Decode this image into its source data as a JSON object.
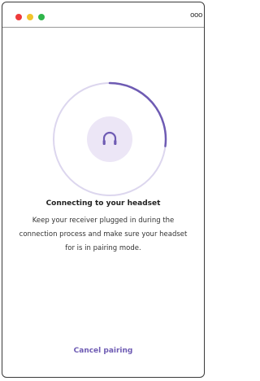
{
  "window": {
    "controls": [
      "close",
      "minimize",
      "maximize"
    ],
    "more_icon": "more-dots-icon",
    "more_glyph": "ooo"
  },
  "status": {
    "icon": "headset-icon",
    "progress": 0.27,
    "title": "Connecting to your headset",
    "description": "Keep your receiver plugged in during the connection process and make sure your headset for is in pairing mode."
  },
  "actions": {
    "cancel_label": "Cancel pairing"
  },
  "colors": {
    "close": "#ee3b3b",
    "minimize": "#f2c32b",
    "maximize": "#2fb54a",
    "accent": "#6e5bb3",
    "ring_track": "#dcd6ee",
    "icon_bg": "#ece6f6"
  }
}
